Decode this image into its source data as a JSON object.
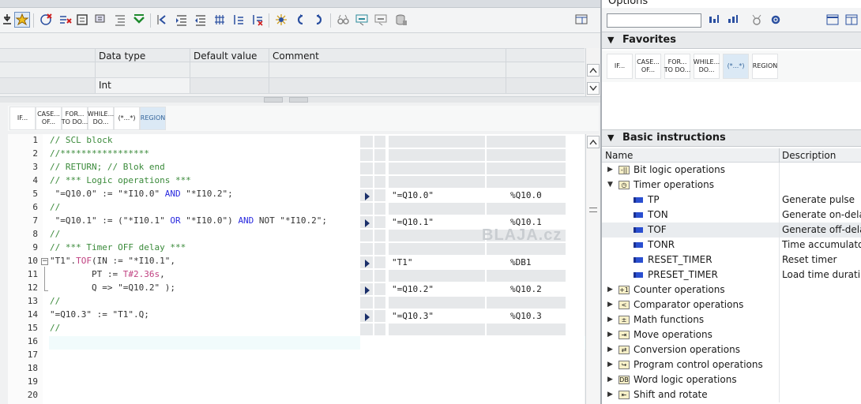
{
  "left": {
    "interface": {
      "headers": [
        "",
        "Data type",
        "Default value",
        "Comment"
      ],
      "row2": {
        "data_type": "Int"
      }
    },
    "scl_buttons": [
      "IF...",
      "CASE...\nOF...",
      "FOR...\nTO DO...",
      "WHILE...\nDO...",
      "(*...*)",
      "REGION"
    ],
    "code_lines": [
      {
        "n": "1",
        "parts": [
          {
            "t": "// SCL block",
            "c": "cm"
          }
        ]
      },
      {
        "n": "2",
        "parts": [
          {
            "t": "//*****************",
            "c": "cm"
          }
        ]
      },
      {
        "n": "3",
        "parts": [
          {
            "t": "// RETURN; // Blok end",
            "c": "cm"
          }
        ]
      },
      {
        "n": "4",
        "parts": [
          {
            "t": "// *** Logic operations ***",
            "c": "cm"
          }
        ]
      },
      {
        "n": "5",
        "parts": [
          {
            "t": " \"=Q10.0\" := \"*I10.0\" ",
            "c": "var"
          },
          {
            "t": "AND",
            "c": "kw"
          },
          {
            "t": " \"*I10.2\";",
            "c": "var"
          }
        ]
      },
      {
        "n": "6",
        "parts": [
          {
            "t": "//",
            "c": "cm"
          }
        ]
      },
      {
        "n": "7",
        "parts": [
          {
            "t": " \"=Q10.1\" := (\"*I10.1\" ",
            "c": "var"
          },
          {
            "t": "OR",
            "c": "kw"
          },
          {
            "t": " \"*I10.0\") ",
            "c": "var"
          },
          {
            "t": "AND",
            "c": "kw"
          },
          {
            "t": " NOT \"*I10.2\";",
            "c": "var"
          }
        ]
      },
      {
        "n": "8",
        "parts": [
          {
            "t": "//",
            "c": "cm"
          }
        ]
      },
      {
        "n": "9",
        "parts": [
          {
            "t": "// *** Timer OFF delay ***",
            "c": "cm"
          }
        ]
      },
      {
        "n": "10",
        "parts": [
          {
            "t": "\"T1\".",
            "c": "var"
          },
          {
            "t": "TOF",
            "c": "ph"
          },
          {
            "t": "(IN := \"*I10.1\",",
            "c": "var"
          }
        ]
      },
      {
        "n": "11",
        "parts": [
          {
            "t": "        PT := ",
            "c": "var"
          },
          {
            "t": "T#2.36s",
            "c": "ph"
          },
          {
            "t": ",",
            "c": "var"
          }
        ]
      },
      {
        "n": "12",
        "parts": [
          {
            "t": "        Q => \"=Q10.2\" );",
            "c": "var"
          }
        ]
      },
      {
        "n": "13",
        "parts": [
          {
            "t": "//",
            "c": "cm"
          }
        ]
      },
      {
        "n": "14",
        "parts": [
          {
            "t": "\"=Q10.3\" := \"T1\".Q;",
            "c": "var"
          }
        ]
      },
      {
        "n": "15",
        "parts": [
          {
            "t": "//",
            "c": "cm"
          }
        ]
      },
      {
        "n": "16",
        "parts": []
      },
      {
        "n": "17",
        "parts": []
      },
      {
        "n": "18",
        "parts": []
      },
      {
        "n": "19",
        "parts": []
      },
      {
        "n": "20",
        "parts": []
      }
    ],
    "monitor": [
      {
        "line": 5,
        "name": "\"=Q10.0\"",
        "addr": "%Q10.0"
      },
      {
        "line": 7,
        "name": "\"=Q10.1\"",
        "addr": "%Q10.1"
      },
      {
        "line": 10,
        "name": "\"T1\"",
        "addr": "%DB1"
      },
      {
        "line": 12,
        "name": "\"=Q10.2\"",
        "addr": "%Q10.2"
      },
      {
        "line": 14,
        "name": "\"=Q10.3\"",
        "addr": "%Q10.3"
      }
    ],
    "watermark": "BLAJA.cz"
  },
  "right": {
    "title": "Options",
    "favorites": {
      "title": "Favorites",
      "buttons": [
        "IF...",
        "CASE...\nOF...",
        "FOR...\nTO DO...",
        "WHILE...\nDO...",
        "(*...*)",
        "REGION"
      ]
    },
    "basic": {
      "title": "Basic instructions",
      "col_name": "Name",
      "col_desc": "Description",
      "rows": [
        {
          "name": "Bit logic operations",
          "desc": "",
          "level": 0,
          "icon": "bitlogic-icon",
          "glyph": "-||",
          "expanded": false
        },
        {
          "name": "Timer operations",
          "desc": "",
          "level": 0,
          "icon": "timer-icon",
          "glyph": "◷",
          "expanded": true
        },
        {
          "name": "TP",
          "desc": "Generate pulse",
          "level": 1
        },
        {
          "name": "TON",
          "desc": "Generate on-delay",
          "level": 1
        },
        {
          "name": "TOF",
          "desc": "Generate off-delay",
          "level": 1,
          "hl": true
        },
        {
          "name": "TONR",
          "desc": "Time accumulator",
          "level": 1
        },
        {
          "name": "RESET_TIMER",
          "desc": "Reset timer",
          "level": 1
        },
        {
          "name": "PRESET_TIMER",
          "desc": "Load time durati...",
          "level": 1
        },
        {
          "name": "Counter operations",
          "desc": "",
          "level": 0,
          "icon": "counter-icon",
          "glyph": "+1"
        },
        {
          "name": "Comparator operations",
          "desc": "",
          "level": 0,
          "icon": "comparator-icon",
          "glyph": "<"
        },
        {
          "name": "Math functions",
          "desc": "",
          "level": 0,
          "icon": "math-icon",
          "glyph": "±"
        },
        {
          "name": "Move operations",
          "desc": "",
          "level": 0,
          "icon": "move-icon",
          "glyph": "⇥"
        },
        {
          "name": "Conversion operations",
          "desc": "",
          "level": 0,
          "icon": "conversion-icon",
          "glyph": "⇄"
        },
        {
          "name": "Program control operations",
          "desc": "",
          "level": 0,
          "icon": "program-control-icon",
          "glyph": "↪"
        },
        {
          "name": "Word logic operations",
          "desc": "",
          "level": 0,
          "icon": "word-logic-icon",
          "glyph": "DB"
        },
        {
          "name": "Shift and rotate",
          "desc": "",
          "level": 0,
          "icon": "shift-rotate-icon",
          "glyph": "⇤"
        }
      ]
    }
  }
}
